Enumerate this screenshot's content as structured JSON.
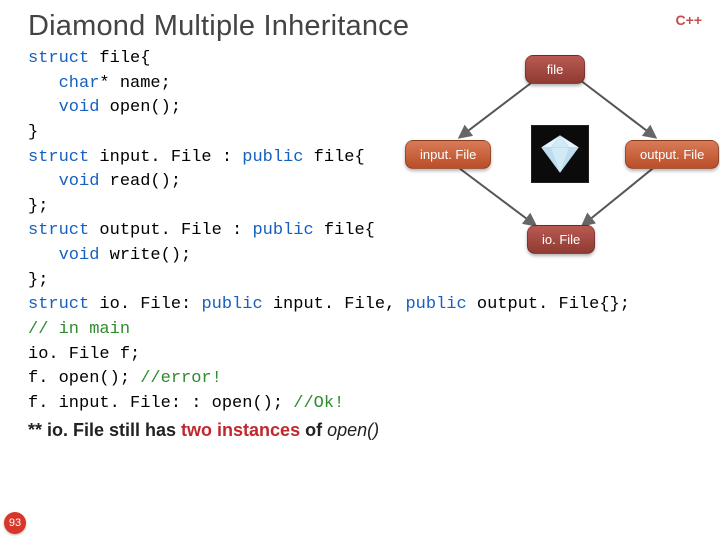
{
  "slide": {
    "title": "Diamond Multiple Inheritance",
    "language_badge": "C++",
    "number": "93"
  },
  "code": {
    "kw_struct": "struct",
    "kw_char": "char",
    "kw_void": "void",
    "kw_public": "public",
    "l1_a": " file{",
    "l2_a": "* name;",
    "l3_a": " open();",
    "l4": "}",
    "l5_a": " input. File : ",
    "l5_b": " file{",
    "l6_a": " read();",
    "l7": "};",
    "l8_a": " output. File : ",
    "l8_b": " file{",
    "l9_a": " write();",
    "l10": "};",
    "l11_a": " io. File: ",
    "l11_b": " input. File, ",
    "l11_c": " output. File{};",
    "l12_cm": "// in main",
    "l13": "io. File f;",
    "l14_a": "f. open(); ",
    "l14_cm": "//error!",
    "l15_a": "f. input. File: : open(); ",
    "l15_cm": "//Ok!"
  },
  "footnote": {
    "prefix": "** io. File still has ",
    "emph": "two instances",
    "mid": " of ",
    "fn": "open()"
  },
  "diagram": {
    "top": "file",
    "left": "input. File",
    "right": "output. File",
    "bottom": "io. File",
    "center_icon": "diamond-image"
  }
}
